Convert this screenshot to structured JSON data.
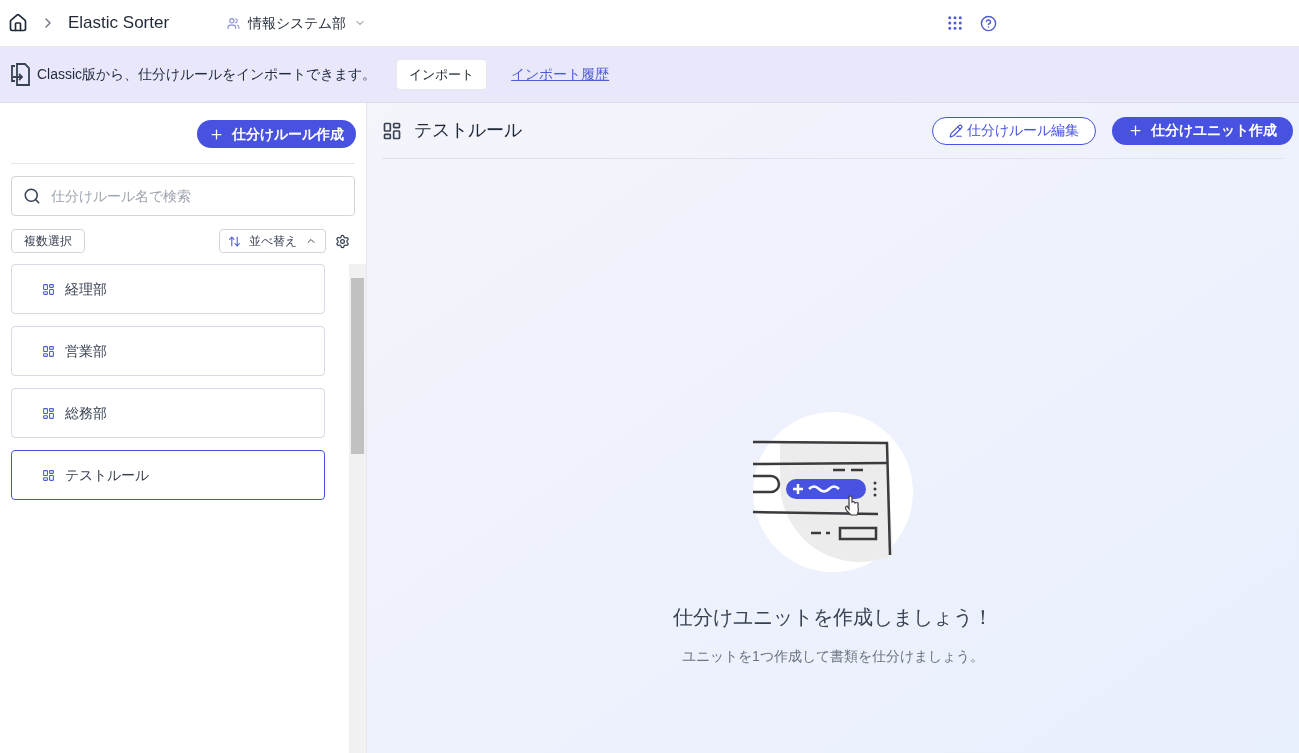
{
  "header": {
    "app_title": "Elastic Sorter",
    "organization": "情報システム部"
  },
  "banner": {
    "message": "Classic版から、仕分けルールをインポートできます。",
    "import_button": "インポート",
    "history_link": "インポート履歴"
  },
  "sidebar": {
    "create_button": "仕分けルール作成",
    "search": {
      "placeholder": "仕分けルール名で検索"
    },
    "multi_select_button": "複数選択",
    "sort_button": "並べ替え",
    "rules": [
      {
        "name": "経理部",
        "selected": false
      },
      {
        "name": "営業部",
        "selected": false
      },
      {
        "name": "総務部",
        "selected": false
      },
      {
        "name": "テストルール",
        "selected": true
      }
    ]
  },
  "main": {
    "title": "テストルール",
    "edit_button": "仕分けルール編集",
    "create_unit_button": "仕分けユニット作成",
    "empty_title": "仕分けユニットを作成しましょう！",
    "empty_text": "ユニットを1つ作成して書類を仕分けましょう。"
  }
}
